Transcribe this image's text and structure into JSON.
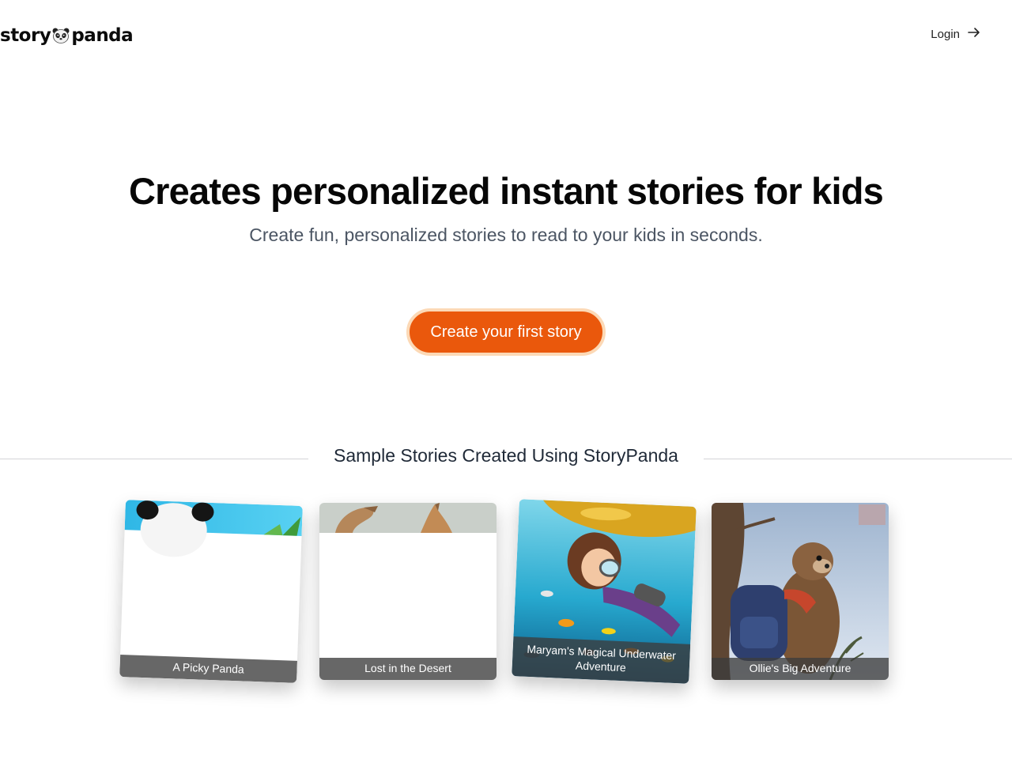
{
  "header": {
    "logo_left": "story",
    "logo_right": "panda",
    "login_label": "Login"
  },
  "hero": {
    "title": "Creates personalized instant stories for kids",
    "subtitle": "Create fun, personalized stories to read to your kids in seconds.",
    "cta_label": "Create your first story"
  },
  "samples": {
    "title": "Sample Stories Created Using StoryPanda",
    "stories": [
      {
        "title": "A Picky Panda",
        "icon": "panda-illustration"
      },
      {
        "title": "Lost in the Desert",
        "icon": "camel-illustration"
      },
      {
        "title": "Maryam's Magical Underwater Adventure",
        "icon": "diver-illustration"
      },
      {
        "title": "Ollie's Big Adventure",
        "icon": "otter-illustration"
      }
    ]
  },
  "colors": {
    "accent": "#ea580c",
    "accent_ring": "#fcd9b6",
    "subtitle": "#4b5563"
  }
}
